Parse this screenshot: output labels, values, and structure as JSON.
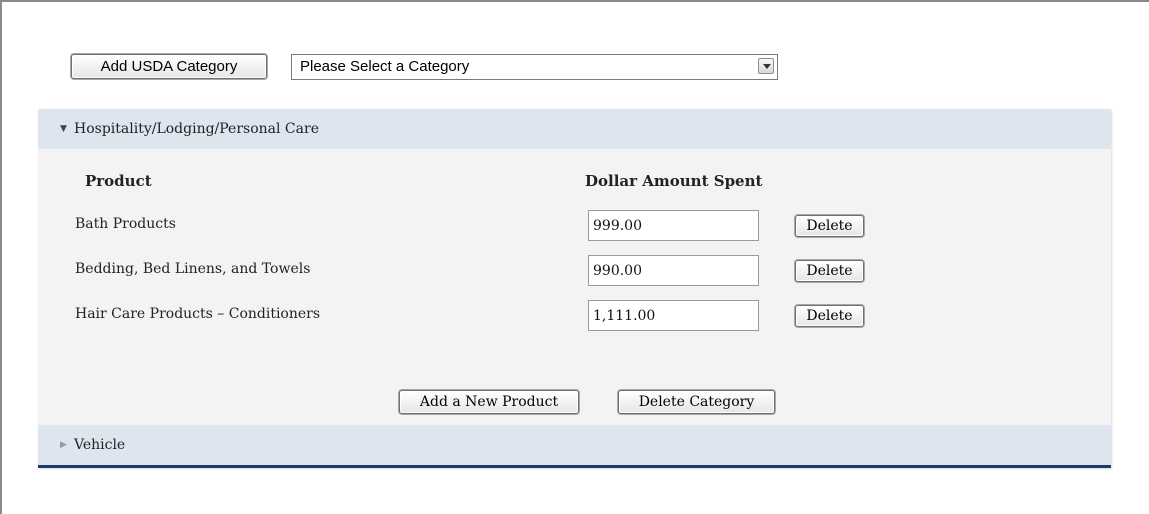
{
  "toolbar": {
    "add_category_label": "Add USDA Category",
    "category_select_value": "Please Select a Category"
  },
  "sections": [
    {
      "title": "Hospitality/Lodging/Personal Care",
      "expanded": true,
      "columns": {
        "product": "Product",
        "amount": "Dollar Amount Spent"
      },
      "products": [
        {
          "name": "Bath Products",
          "amount": "999.00",
          "delete_label": "Delete"
        },
        {
          "name": "Bedding, Bed Linens, and Towels",
          "amount": "990.00",
          "delete_label": "Delete"
        },
        {
          "name": "Hair Care Products – Conditioners",
          "amount": "1,111.00",
          "delete_label": "Delete"
        }
      ],
      "add_product_label": "Add a New Product",
      "delete_category_label": "Delete Category"
    },
    {
      "title": "Vehicle",
      "expanded": false
    }
  ],
  "colors": {
    "section_header_bg": "#dde5ef",
    "panel_bg": "#f3f3f3",
    "panel_bottom_border": "#1e3a6a"
  }
}
